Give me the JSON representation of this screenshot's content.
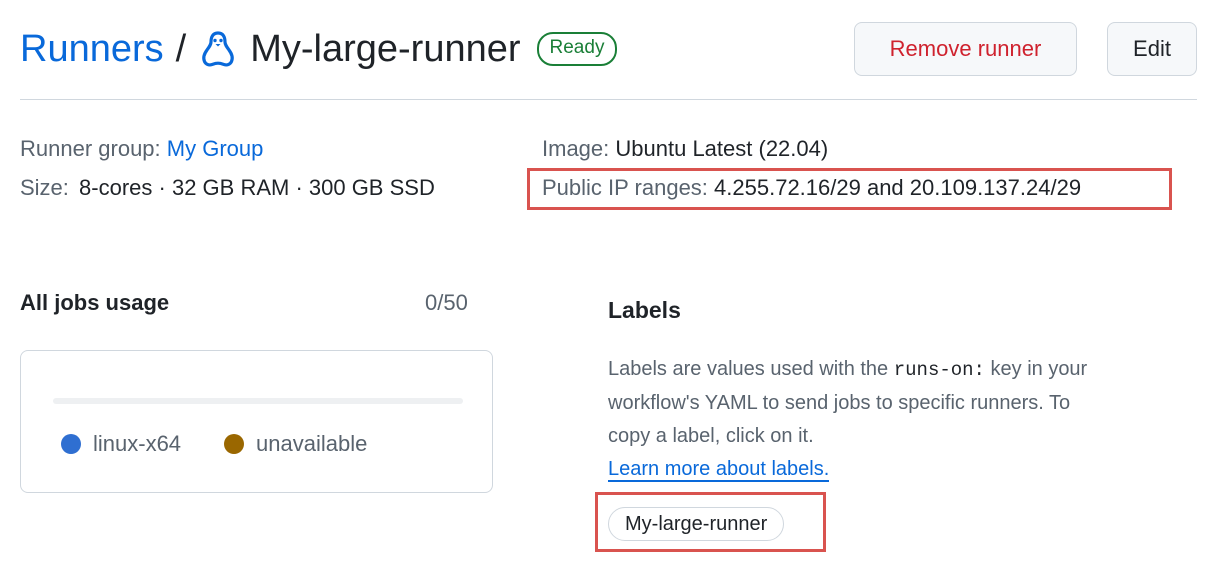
{
  "header": {
    "breadcrumb_root": "Runners",
    "separator": "/",
    "runner_name": "My-large-runner",
    "status_badge": "Ready",
    "runner_icon": "linux-penguin-icon",
    "remove_button": "Remove runner",
    "edit_button": "Edit"
  },
  "details": {
    "runner_group_label": "Runner group:",
    "runner_group_value": "My Group",
    "size_label": "Size:",
    "size_value": "8-cores · 32 GB RAM · 300 GB SSD",
    "image_label": "Image:",
    "image_value": "Ubuntu Latest (22.04)",
    "ip_label": "Public IP ranges:",
    "ip_value": "4.255.72.16/29 and 20.109.137.24/29"
  },
  "jobs_usage": {
    "title": "All jobs usage",
    "count": "0/50",
    "used": 0,
    "total": 50,
    "legend": [
      {
        "label": "linux-x64",
        "color": "#2f6fd1"
      },
      {
        "label": "unavailable",
        "color": "#9a6700"
      }
    ]
  },
  "labels_section": {
    "title": "Labels",
    "desc_part1": "Labels are values used with the ",
    "desc_code": "runs-on:",
    "desc_part2": " key in your workflow's YAML to send jobs to specific runners. To copy a label, click on it.",
    "learn_more": "Learn more about labels.",
    "chips": [
      "My-large-runner"
    ]
  },
  "colors": {
    "link": "#0969da",
    "ready_green": "#1a7f37",
    "danger": "#cf222e",
    "highlight_box": "#d9534f"
  }
}
